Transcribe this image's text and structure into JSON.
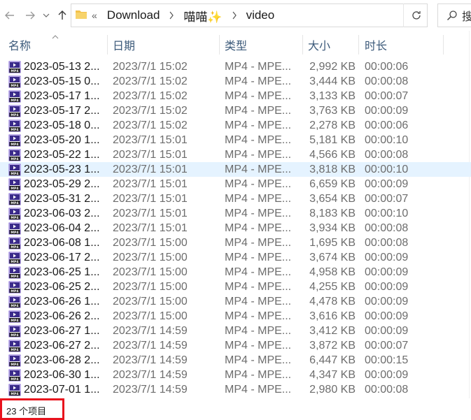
{
  "nav": {
    "overflow": "«",
    "crumbs": [
      "Download",
      "喵喵✨",
      "video"
    ],
    "search_text": "搜"
  },
  "columns": {
    "name": "名称",
    "date": "日期",
    "type": "类型",
    "size": "大小",
    "duration": "时长"
  },
  "files": [
    {
      "name": "2023-05-13 2...",
      "date": "2023/7/1 15:02",
      "type": "MP4 - MPE...",
      "size": "2,992 KB",
      "duration": "00:00:06"
    },
    {
      "name": "2023-05-15 0...",
      "date": "2023/7/1 15:02",
      "type": "MP4 - MPE...",
      "size": "3,444 KB",
      "duration": "00:00:08"
    },
    {
      "name": "2023-05-17 1...",
      "date": "2023/7/1 15:02",
      "type": "MP4 - MPE...",
      "size": "3,133 KB",
      "duration": "00:00:07"
    },
    {
      "name": "2023-05-17 2...",
      "date": "2023/7/1 15:02",
      "type": "MP4 - MPE...",
      "size": "3,763 KB",
      "duration": "00:00:09"
    },
    {
      "name": "2023-05-18 0...",
      "date": "2023/7/1 15:02",
      "type": "MP4 - MPE...",
      "size": "2,278 KB",
      "duration": "00:00:06"
    },
    {
      "name": "2023-05-20 1...",
      "date": "2023/7/1 15:01",
      "type": "MP4 - MPE...",
      "size": "5,181 KB",
      "duration": "00:00:10"
    },
    {
      "name": "2023-05-22 1...",
      "date": "2023/7/1 15:01",
      "type": "MP4 - MPE...",
      "size": "4,566 KB",
      "duration": "00:00:08"
    },
    {
      "name": "2023-05-23 1...",
      "date": "2023/7/1 15:01",
      "type": "MP4 - MPE...",
      "size": "3,818 KB",
      "duration": "00:00:10",
      "selected": true
    },
    {
      "name": "2023-05-29 2...",
      "date": "2023/7/1 15:01",
      "type": "MP4 - MPE...",
      "size": "6,659 KB",
      "duration": "00:00:09"
    },
    {
      "name": "2023-05-31 2...",
      "date": "2023/7/1 15:01",
      "type": "MP4 - MPE...",
      "size": "3,654 KB",
      "duration": "00:00:07"
    },
    {
      "name": "2023-06-03 2...",
      "date": "2023/7/1 15:01",
      "type": "MP4 - MPE...",
      "size": "8,183 KB",
      "duration": "00:00:10"
    },
    {
      "name": "2023-06-04 2...",
      "date": "2023/7/1 15:01",
      "type": "MP4 - MPE...",
      "size": "3,934 KB",
      "duration": "00:00:08"
    },
    {
      "name": "2023-06-08 1...",
      "date": "2023/7/1 15:00",
      "type": "MP4 - MPE...",
      "size": "1,695 KB",
      "duration": "00:00:08"
    },
    {
      "name": "2023-06-17 2...",
      "date": "2023/7/1 15:00",
      "type": "MP4 - MPE...",
      "size": "3,674 KB",
      "duration": "00:00:09"
    },
    {
      "name": "2023-06-25 1...",
      "date": "2023/7/1 15:00",
      "type": "MP4 - MPE...",
      "size": "4,958 KB",
      "duration": "00:00:09"
    },
    {
      "name": "2023-06-25 2...",
      "date": "2023/7/1 15:00",
      "type": "MP4 - MPE...",
      "size": "4,255 KB",
      "duration": "00:00:09"
    },
    {
      "name": "2023-06-26 1...",
      "date": "2023/7/1 15:00",
      "type": "MP4 - MPE...",
      "size": "4,478 KB",
      "duration": "00:00:09"
    },
    {
      "name": "2023-06-26 2...",
      "date": "2023/7/1 15:00",
      "type": "MP4 - MPE...",
      "size": "3,616 KB",
      "duration": "00:00:09"
    },
    {
      "name": "2023-06-27 1...",
      "date": "2023/7/1 14:59",
      "type": "MP4 - MPE...",
      "size": "3,412 KB",
      "duration": "00:00:09"
    },
    {
      "name": "2023-06-27 2...",
      "date": "2023/7/1 14:59",
      "type": "MP4 - MPE...",
      "size": "3,872 KB",
      "duration": "00:00:07"
    },
    {
      "name": "2023-06-28 2...",
      "date": "2023/7/1 14:59",
      "type": "MP4 - MPE...",
      "size": "6,447 KB",
      "duration": "00:00:15"
    },
    {
      "name": "2023-06-30 1...",
      "date": "2023/7/1 14:59",
      "type": "MP4 - MPE...",
      "size": "4,347 KB",
      "duration": "00:00:09"
    },
    {
      "name": "2023-07-01 1...",
      "date": "2023/7/1 14:59",
      "type": "MP4 - MPE...",
      "size": "2,980 KB",
      "duration": "00:00:08"
    }
  ],
  "status": {
    "item_count": "23 个项目"
  },
  "icons": {
    "back": "arrow-left-icon",
    "forward": "arrow-right-icon",
    "recent": "chevron-down-icon",
    "up": "arrow-up-icon",
    "folder": "folder-icon",
    "refresh": "refresh-icon",
    "search": "search-icon",
    "file": "mp4-file-icon"
  },
  "colors": {
    "selected_row": "#e5f3ff",
    "header_text": "#3c5a7a",
    "highlight_box": "#e8121d",
    "folder": "#f3c24b"
  }
}
